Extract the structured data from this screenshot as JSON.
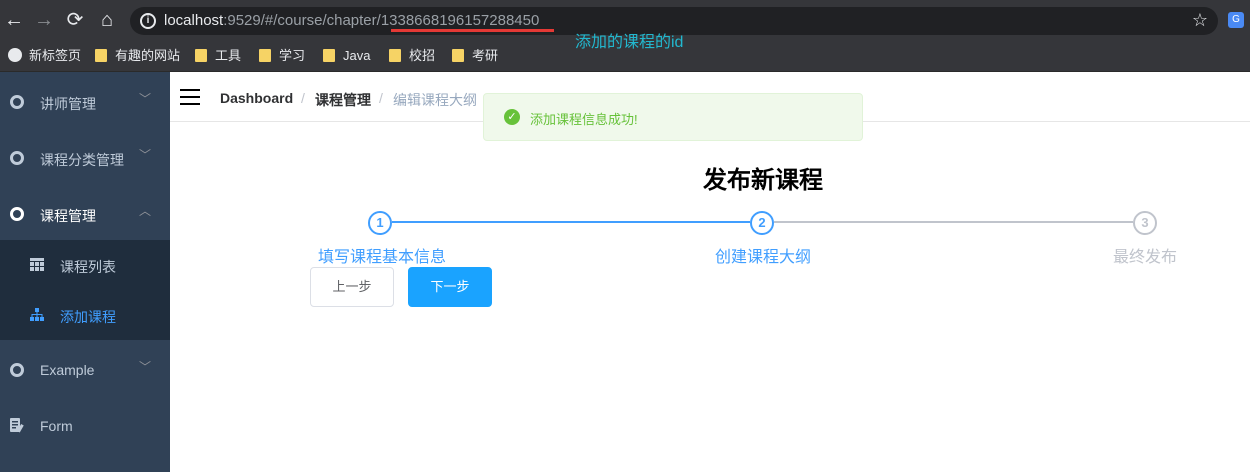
{
  "browser": {
    "url_host": "localhost",
    "url_rest": ":9529/#/course/chapter/",
    "url_course_id": "1338668196157288450",
    "annotation": "添加的课程的id",
    "bookmarks": [
      {
        "label": "新标签页"
      },
      {
        "label": "有趣的网站"
      },
      {
        "label": "工具"
      },
      {
        "label": "学习"
      },
      {
        "label": "Java"
      },
      {
        "label": "校招"
      },
      {
        "label": "考研"
      }
    ]
  },
  "sidebar": {
    "items": [
      {
        "label": "讲师管理",
        "icon": "gear-icon"
      },
      {
        "label": "课程分类管理",
        "icon": "gear-icon"
      },
      {
        "label": "课程管理",
        "icon": "gear-icon"
      },
      {
        "label": "Example",
        "icon": "gear-icon"
      },
      {
        "label": "Form",
        "icon": "form-icon"
      }
    ],
    "submenu": [
      {
        "label": "课程列表",
        "icon": "table-icon"
      },
      {
        "label": "添加课程",
        "icon": "tree-icon"
      }
    ]
  },
  "breadcrumb": [
    "Dashboard",
    "课程管理",
    "编辑课程大纲"
  ],
  "toast": {
    "message": "添加课程信息成功!"
  },
  "page": {
    "title": "发布新课程"
  },
  "steps": [
    {
      "num": "1",
      "label": "填写课程基本信息"
    },
    {
      "num": "2",
      "label": "创建课程大纲"
    },
    {
      "num": "3",
      "label": "最终发布"
    }
  ],
  "buttons": {
    "prev": "上一步",
    "next": "下一步"
  },
  "colors": {
    "sidebar_bg": "#304156",
    "primary": "#409eff",
    "success": "#67c23a"
  }
}
